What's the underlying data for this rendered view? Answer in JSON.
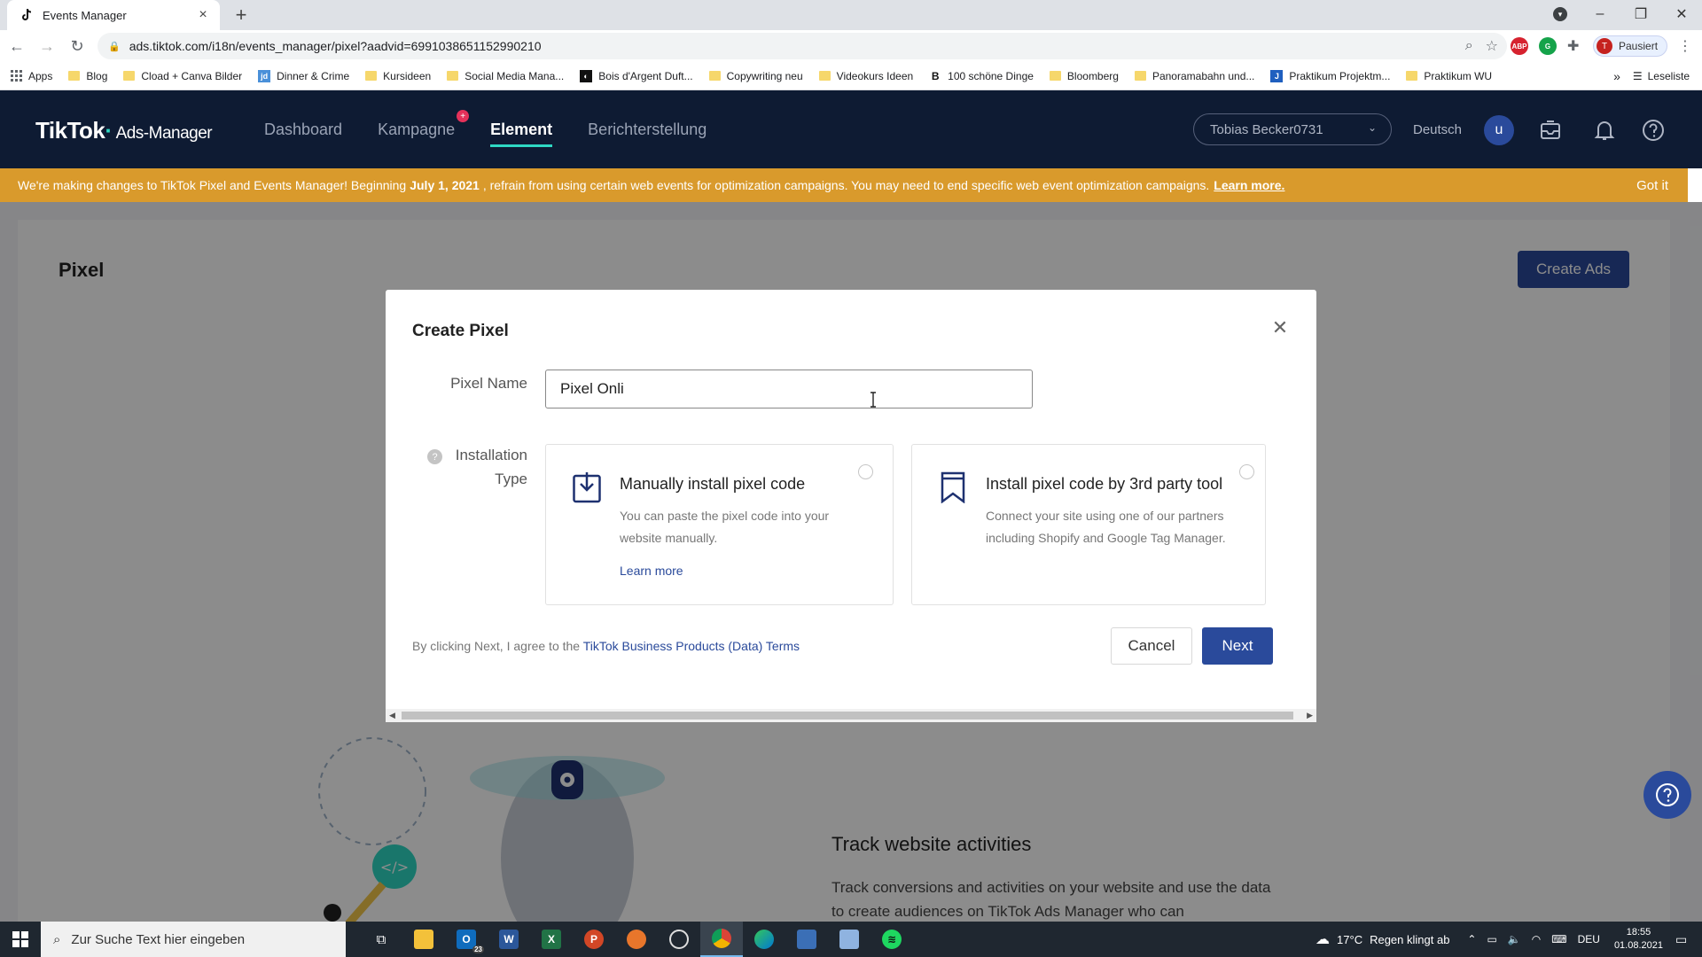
{
  "browser": {
    "tab_title": "Events Manager",
    "new_tab": "+",
    "url": "ads.tiktok.com/i18n/events_manager/pixel?aadvid=6991038651152990210",
    "profile_status": "Pausiert",
    "profile_initial": "T",
    "bookmarks": [
      {
        "label": "Apps",
        "icon": "apps-grid-icon"
      },
      {
        "label": "Blog",
        "icon": "folder-icon"
      },
      {
        "label": "Cload + Canva Bilder",
        "icon": "folder-icon"
      },
      {
        "label": "Dinner & Crime",
        "icon": "jd-icon"
      },
      {
        "label": "Kursideen",
        "icon": "folder-icon"
      },
      {
        "label": "Social Media Mana...",
        "icon": "folder-icon"
      },
      {
        "label": "Bois d'Argent Duft...",
        "icon": "site-icon"
      },
      {
        "label": "Copywriting neu",
        "icon": "folder-icon"
      },
      {
        "label": "Videokurs Ideen",
        "icon": "folder-icon"
      },
      {
        "label": "100 schöne Dinge",
        "icon": "b-icon"
      },
      {
        "label": "Bloomberg",
        "icon": "folder-icon"
      },
      {
        "label": "Panoramabahn und...",
        "icon": "folder-icon"
      },
      {
        "label": "Praktikum Projektm...",
        "icon": "j-icon"
      },
      {
        "label": "Praktikum WU",
        "icon": "folder-icon"
      }
    ],
    "bookmarks_more": "»",
    "reading_list": "Leseliste"
  },
  "header": {
    "logo": "TikTok",
    "logo_sub": "Ads-Manager",
    "nav": [
      {
        "label": "Dashboard",
        "active": false
      },
      {
        "label": "Kampagne",
        "active": false,
        "badge": true
      },
      {
        "label": "Element",
        "active": true
      },
      {
        "label": "Berichterstellung",
        "active": false
      }
    ],
    "account": "Tobias Becker0731",
    "language": "Deutsch",
    "user_initial": "u"
  },
  "announcement": {
    "text_before": "We're making changes to TikTok Pixel and Events Manager! Beginning",
    "date": "July 1, 2021",
    "text_after": ", refrain from using certain web events for optimization campaigns. You may need to end specific web event optimization campaigns.",
    "learn_more": "Learn more.",
    "got_it": "Got it"
  },
  "page": {
    "title": "Pixel",
    "create_ads": "Create Ads",
    "track_title": "Track website activities",
    "track_text": "Track conversions and activities on your website and use the data to create audiences on TikTok Ads Manager who can"
  },
  "modal": {
    "title": "Create Pixel",
    "pixel_name_label": "Pixel Name",
    "pixel_name_value": "Pixel Onli",
    "installation_label_1": "Installation",
    "installation_label_2": "Type",
    "option_manual": {
      "title": "Manually install pixel code",
      "desc": "You can paste the pixel code into your website manually.",
      "learn_more": "Learn more"
    },
    "option_third_party": {
      "title": "Install pixel code by 3rd party tool",
      "desc": "Connect your site using one of our partners including Shopify and Google Tag Manager."
    },
    "agree_text": "By clicking Next, I agree to the",
    "terms_link": "TikTok Business Products (Data) Terms",
    "cancel": "Cancel",
    "next": "Next"
  },
  "taskbar": {
    "search_placeholder": "Zur Suche Text hier eingeben",
    "outlook_badge": "23",
    "temperature": "17°C",
    "weather_text": "Regen klingt ab",
    "keyboard_lang": "DEU",
    "time": "18:55",
    "date": "01.08.2021"
  },
  "colors": {
    "header_bg": "#0e1b33",
    "accent_teal": "#2ed8c3",
    "primary_blue": "#2a4a9b",
    "announce_orange": "#d99a2c"
  }
}
